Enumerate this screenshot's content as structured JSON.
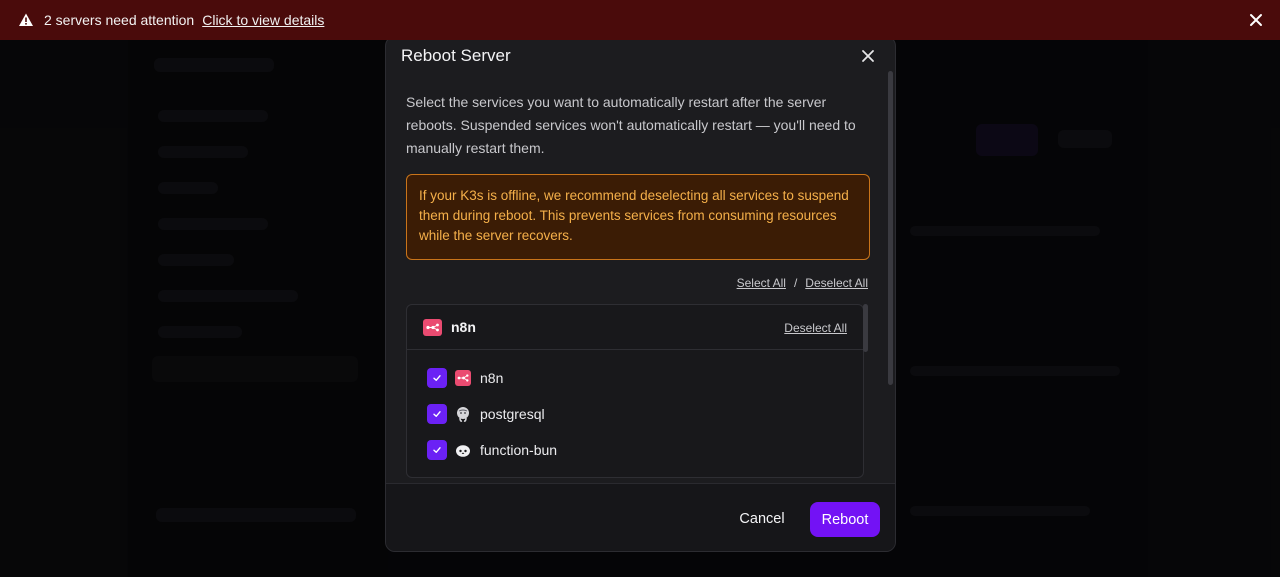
{
  "banner": {
    "message": "2 servers need attention",
    "link": "Click to view details"
  },
  "modal": {
    "title": "Reboot Server",
    "description": "Select the services you want to automatically restart after the server reboots. Suspended services won't automatically restart — you'll need to manually restart them.",
    "alert": "If your K3s is offline, we recommend deselecting all services to suspend them during reboot. This prevents services from consuming resources while the server recovers.",
    "select_all": "Select All",
    "separator": "/",
    "deselect_all": "Deselect All",
    "group": {
      "name": "n8n",
      "deselect_all": "Deselect All",
      "services": [
        {
          "label": "n8n",
          "checked": true,
          "icon": "n8n-icon"
        },
        {
          "label": "postgresql",
          "checked": true,
          "icon": "postgresql-elephant-icon"
        },
        {
          "label": "function-bun",
          "checked": true,
          "icon": "bun-icon"
        }
      ]
    },
    "cancel_label": "Cancel",
    "reboot_label": "Reboot"
  },
  "colors": {
    "banner_bg": "#4a0b0b",
    "accent": "#7312f5",
    "warning_text": "#f5b04a",
    "warning_border": "#c9741a",
    "n8n_brand": "#ea4b71"
  }
}
